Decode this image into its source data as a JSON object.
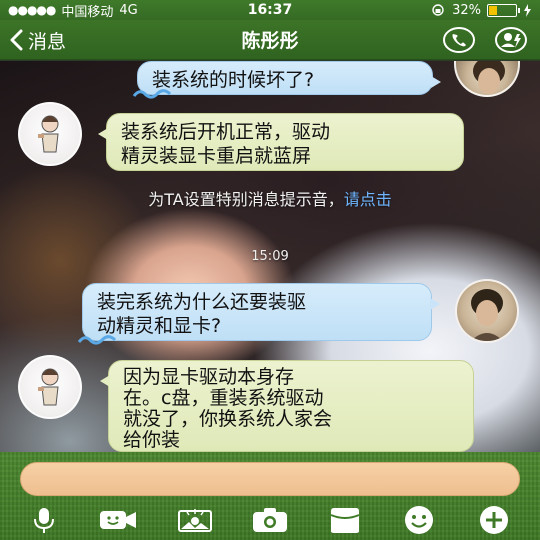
{
  "status_bar": {
    "carrier": "中国移动",
    "network": "4G",
    "time": "16:37",
    "battery_percent_label": "32%",
    "battery_level": 0.32,
    "signal_dots": "●●●●●"
  },
  "nav": {
    "back_label": "消息",
    "title": "陈彤彤"
  },
  "messages": [
    {
      "side": "out",
      "text": "装系统的时候坏了?"
    },
    {
      "side": "in",
      "line1": "装系统后开机正常，驱动",
      "line2": "精灵装显卡重启就蓝屏"
    },
    {
      "side": "out",
      "line1": "装完系统为什么还要装驱",
      "line2": "动精灵和显卡?"
    },
    {
      "side": "in",
      "line1": "因为显卡驱动本身存",
      "line2": "在。c盘，重装系统驱动",
      "line3": "就没了，你换系统人家会",
      "line4": "给你装"
    }
  ],
  "system_tip": {
    "text": "为TA设置特别消息提示音，",
    "link": "请点击"
  },
  "time_divider": "15:09",
  "input": {
    "value": "",
    "placeholder": ""
  },
  "toolbar": [
    "microphone-icon",
    "video-icon",
    "photo-icon",
    "camera-icon",
    "folder-icon",
    "emoji-icon",
    "plus-icon"
  ],
  "colors": {
    "nav_green": "#3c7427",
    "outgoing_bubble": "#cfe6f9",
    "incoming_bubble": "#e5edc3",
    "link": "#6fb6ff",
    "input_pill": "#f2c89a",
    "battery": "#f2c200"
  }
}
